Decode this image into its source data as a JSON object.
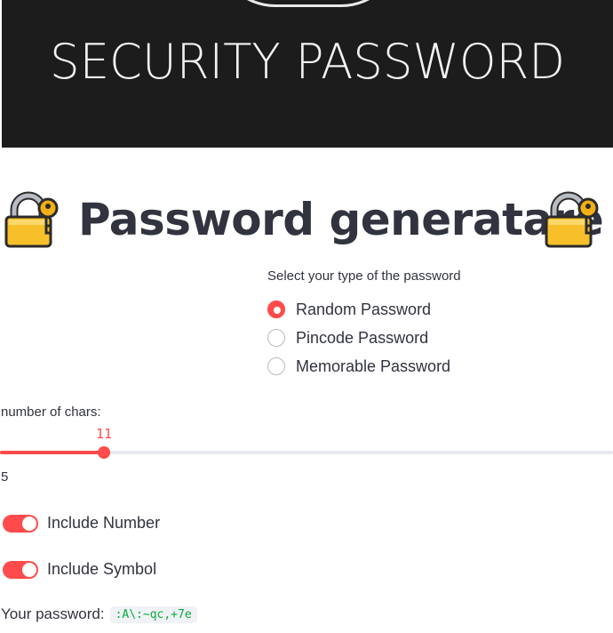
{
  "banner": {
    "text": "SECURITY PASSWORD"
  },
  "title": {
    "icon": "lock-with-key-icon",
    "text": "Password generatare"
  },
  "password_type": {
    "label": "Select your type of the password",
    "options": [
      "Random Password",
      "Pincode Password",
      "Memorable Password"
    ],
    "selected": "Random Password"
  },
  "chars_slider": {
    "label": "number of chars:",
    "value": "11",
    "min_label": "5",
    "fill_fraction": 0.17
  },
  "options": {
    "include_number": {
      "label": "Include Number",
      "on": true
    },
    "include_symbol": {
      "label": "Include Symbol",
      "on": true
    }
  },
  "result": {
    "label": "Your password:",
    "value": ":A\\:~qc,+7e"
  },
  "colors": {
    "accent": "#ff4b4b",
    "text": "#31333f",
    "code_green": "#09ab3b",
    "banner_bg": "#1c1c1c"
  }
}
